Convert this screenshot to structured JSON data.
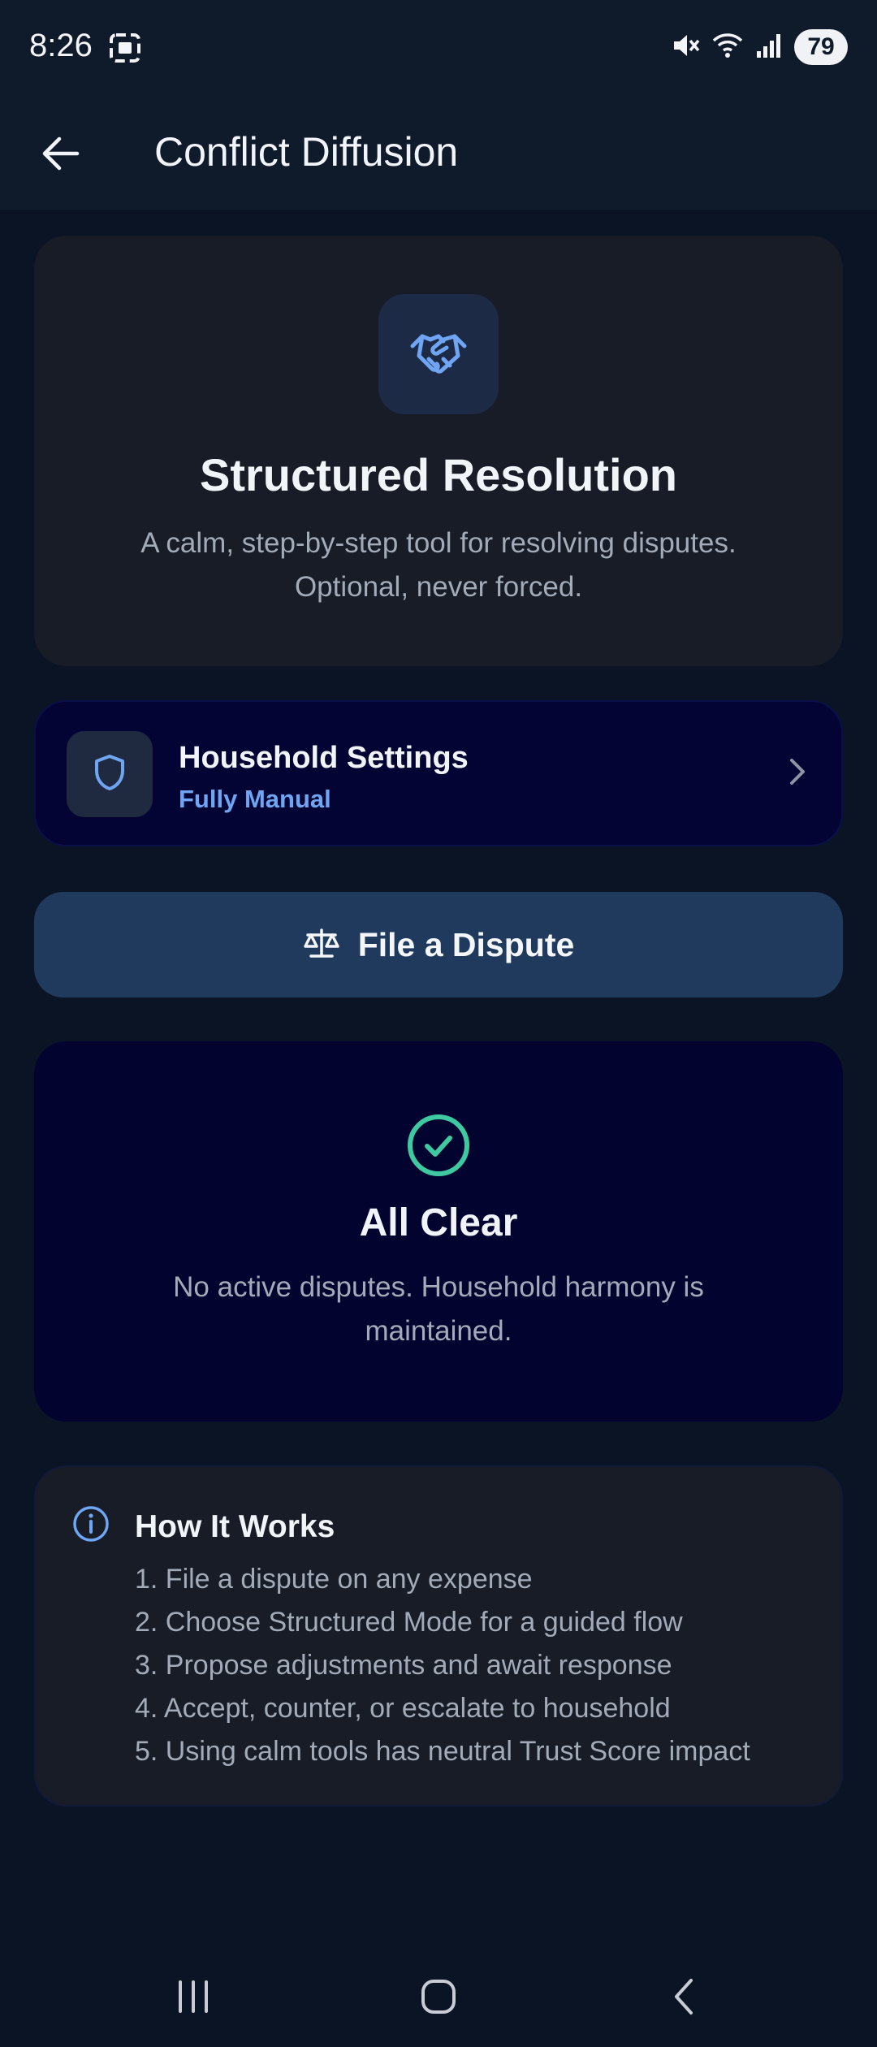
{
  "status_bar": {
    "time": "8:26",
    "battery": "79",
    "icons": [
      "screenshot-icon",
      "mute-icon",
      "wifi-icon",
      "signal-icon"
    ]
  },
  "app_bar": {
    "title": "Conflict Diffusion",
    "back_icon": "arrow-left-icon"
  },
  "hero": {
    "icon": "handshake-icon",
    "title": "Structured Resolution",
    "subtitle": "A calm, step-by-step tool for resolving disputes. Optional, never forced."
  },
  "settings": {
    "icon": "shield-icon",
    "title": "Household Settings",
    "value": "Fully Manual"
  },
  "dispute_button": {
    "icon": "scale-icon",
    "label": "File a Dispute"
  },
  "status_card": {
    "icon": "check-circle-icon",
    "title": "All Clear",
    "text": "No active disputes. Household harmony is maintained."
  },
  "how_it_works": {
    "icon": "info-icon",
    "title": "How It Works",
    "steps": [
      "1. File a dispute on any expense",
      "2. Choose Structured Mode for a guided flow",
      "3. Propose adjustments and await response",
      "4. Accept, counter, or escalate to household",
      "5. Using calm tools has neutral Trust Score impact"
    ]
  },
  "colors": {
    "background": "#0b1424",
    "card": "#171c26",
    "accent_blue": "#6fa5f2",
    "accent_green": "#3ec9a0",
    "button": "#203a5e",
    "navy_card": "#03032f"
  }
}
